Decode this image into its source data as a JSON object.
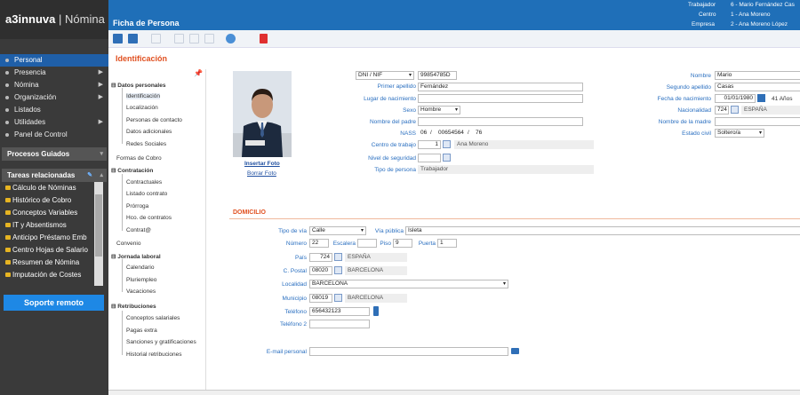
{
  "app": {
    "brand": "a3innuva",
    "separator": "|",
    "module": "Nómina",
    "screen_title": "Ficha de Persona"
  },
  "header": {
    "trabajador_label": "Trabajador",
    "trabajador_value": "6 - Mario Fernández Cas",
    "centro_label": "Centro",
    "centro_value": "1 - Ana Moreno",
    "empresa_label": "Empresa",
    "empresa_value": "2 - Ana Moreno López"
  },
  "sidebar": {
    "menu": [
      "Personal",
      "Presencia",
      "Nómina",
      "Organización",
      "Listados",
      "Utilidades",
      "Panel de Control"
    ],
    "procesos": "Procesos Guiados",
    "tareas_title": "Tareas relacionadas",
    "tareas": [
      "Cálculo de Nóminas",
      "Histórico de Cobro",
      "Conceptos Variables",
      "IT y Absentismos",
      "Anticipo Préstamo Emb",
      "Centro Hojas de Salario",
      "Resumen de Nómina",
      "Imputación de Costes"
    ],
    "soporte": "Soporte remoto"
  },
  "section_title": "Identificación",
  "tree": {
    "datos_personales": "Datos personales",
    "dp_items": [
      "Identificación",
      "Localización",
      "Personas de contacto",
      "Datos adicionales",
      "Redes Sociales"
    ],
    "formas_cobro": "Formas de Cobro",
    "contratacion": "Contratación",
    "c_items": [
      "Contractuales",
      "Listado contrato",
      "Prórroga",
      "Hco. de contratos",
      "Contrat@"
    ],
    "convenio": "Convenio",
    "jornada": "Jornada laboral",
    "j_items": [
      "Calendario",
      "Pluriempleo",
      "Vacaciones"
    ],
    "retribuciones": "Retribuciones",
    "r_items": [
      "Conceptos salariales",
      "Pagas extra",
      "Sanciones y gratificaciones",
      "Historial retribuciones"
    ]
  },
  "photo": {
    "insertar": "Insertar Foto",
    "borrar": "Borrar Foto"
  },
  "ident": {
    "doc_type": "DNI / NIF",
    "doc_value": "99854785D",
    "primer_apellido_label": "Primer apellido",
    "primer_apellido": "Fernández",
    "lugar_nac_label": "Lugar de nacimiento",
    "lugar_nac": "",
    "sexo_label": "Sexo",
    "sexo": "Hombre",
    "nombre_padre_label": "Nombre del padre",
    "nombre_padre": "",
    "nass_label": "NASS",
    "nass_1": "06",
    "nass_2": "00654564",
    "nass_3": "76",
    "centro_label": "Centro de trabajo",
    "centro_num": "1",
    "centro_name": "Ana Moreno",
    "nivel_label": "Nivel de seguridad",
    "nivel": "",
    "tipo_label": "Tipo de persona",
    "tipo": "Trabajador",
    "nombre_label": "Nombre",
    "nombre": "Mario",
    "segundo_label": "Segundo apellido",
    "segundo": "Casas",
    "fnac_label": "Fecha de nacimiento",
    "fnac": "01/01/1980",
    "edad": "41",
    "edad_unit": "Años",
    "nacionalidad_label": "Nacionalidad",
    "nac_code": "724",
    "nac_name": "ESPAÑA",
    "madre_label": "Nombre de la madre",
    "madre": "",
    "civil_label": "Estado civil",
    "civil": "Soltero/a"
  },
  "domicilio": {
    "title": "DOMICILIO",
    "tipo_via_label": "Tipo de vía",
    "tipo_via": "Calle",
    "via_label": "Vía pública",
    "via": "Isleta",
    "numero_label": "Número",
    "numero": "22",
    "escalera_label": "Escalera",
    "escalera": "",
    "piso_label": "Piso",
    "piso": "9",
    "puerta_label": "Puerta",
    "puerta": "1",
    "pais_label": "País",
    "pais_code": "724",
    "pais_name": "ESPAÑA",
    "cp_label": "C. Postal",
    "cp_code": "08020",
    "cp_name": "BARCELONA",
    "localidad_label": "Localidad",
    "localidad": "BARCELONA",
    "municipio_label": "Municipio",
    "mun_code": "08019",
    "mun_name": "BARCELONA",
    "telefono_label": "Teléfono",
    "telefono": "656432123",
    "telefono2_label": "Teléfono 2",
    "telefono2": "",
    "email_label": "E-mail personal",
    "email": ""
  }
}
